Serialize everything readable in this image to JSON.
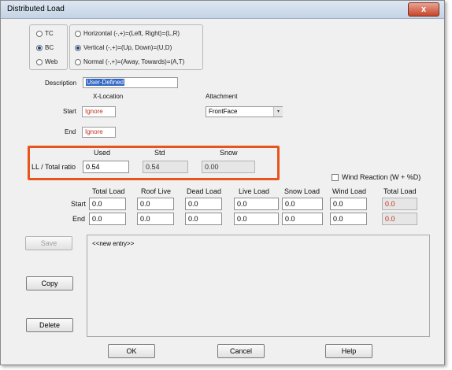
{
  "window": {
    "title": "Distributed Load",
    "close_glyph": "x"
  },
  "face_group": {
    "options": [
      {
        "label": "TC",
        "selected": false
      },
      {
        "label": "BC",
        "selected": true
      },
      {
        "label": "Web",
        "selected": false
      }
    ]
  },
  "direction_group": {
    "options": [
      {
        "label": "Horizontal (-,+)=(Left, Right)=(L,R)",
        "selected": false
      },
      {
        "label": "Vertical (-,+)=(Up, Down)=(U,D)",
        "selected": true
      },
      {
        "label": "Normal (-,+)=(Away, Towards)=(A,T)",
        "selected": false
      }
    ]
  },
  "description": {
    "label": "Description",
    "value": "User-Defined"
  },
  "xlocation": {
    "header": "X-Location",
    "start_label": "Start",
    "start_value": "Ignore",
    "end_label": "End",
    "end_value": "Ignore"
  },
  "attachment": {
    "label": "Attachment",
    "value": "FrontFace"
  },
  "ll_ratio": {
    "row_label": "LL / Total ratio",
    "used_label": "Used",
    "used_value": "0.54",
    "std_label": "Std",
    "std_value": "0.54",
    "snow_label": "Snow",
    "snow_value": "0.00"
  },
  "wind_reaction": {
    "label": "Wind Reaction (W + %D)",
    "checked": false
  },
  "loads_table": {
    "columns": [
      "Total Load",
      "Roof Live",
      "Dead Load",
      "Live Load",
      "Snow Load",
      "Wind Load",
      "Total Load"
    ],
    "start_label": "Start",
    "end_label": "End",
    "start_values": [
      "0.0",
      "0.0",
      "0.0",
      "0.0",
      "0.0",
      "0.0",
      "0.0"
    ],
    "end_values": [
      "0.0",
      "0.0",
      "0.0",
      "0.0",
      "0.0",
      "0.0",
      "0.0"
    ]
  },
  "entries": {
    "items": [
      "<<new entry>>"
    ]
  },
  "buttons": {
    "save": "Save",
    "copy": "Copy",
    "delete": "Delete",
    "ok": "OK",
    "cancel": "Cancel",
    "help": "Help"
  },
  "colors": {
    "highlight_border": "#e8541c",
    "input_text_red": "#c0311e",
    "selection": "#3166c5"
  }
}
